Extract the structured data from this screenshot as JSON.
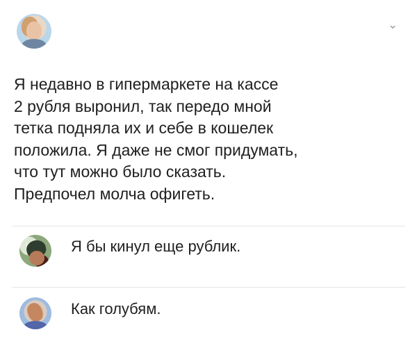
{
  "post": {
    "author_name": "",
    "author_handle": "",
    "text": "Я недавно в гипермаркете на кассе\n2 рубля выронил, так передо мной\nтетка подняла их и себе в кошелек\nположила. Я даже не смог придумать,\nчто тут можно было сказать.\nПредпочел молча офигеть.",
    "menu_icon": "chevron-down-icon"
  },
  "comments": [
    {
      "text": "Я бы кинул еще рублик.",
      "avatar_icon": "user-avatar"
    },
    {
      "text": "Как голубям.",
      "avatar_icon": "user-avatar"
    }
  ],
  "colors": {
    "text": "#202020",
    "divider": "#e5e5e5",
    "chevron": "#9a9a9a"
  }
}
